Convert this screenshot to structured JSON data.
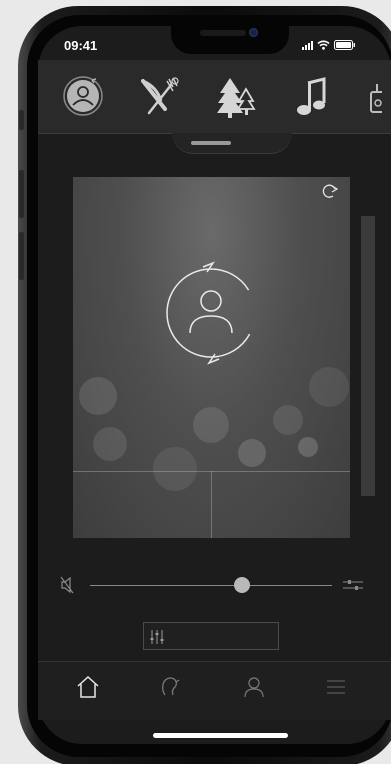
{
  "status_bar": {
    "time": "09:41"
  },
  "top_categories": [
    {
      "icon": "profile-sync-icon",
      "selected": true
    },
    {
      "icon": "knife-fork-icon",
      "selected": false
    },
    {
      "icon": "pine-trees-icon",
      "selected": false
    },
    {
      "icon": "music-note-icon",
      "selected": false
    },
    {
      "icon": "more-category-icon",
      "selected": false
    }
  ],
  "hero_card": {
    "icon": "profile-sync-icon",
    "corner_icon": "redo-arrow-icon"
  },
  "volume": {
    "level": 0.63,
    "mute_icon": "speaker-muted-icon",
    "settings_icon": "adjust-icon"
  },
  "eq_button": {
    "icon": "equalizer-icon"
  },
  "bottom_nav": [
    {
      "icon": "home-icon",
      "active": true
    },
    {
      "icon": "hearing-icon",
      "active": false
    },
    {
      "icon": "user-icon",
      "active": false
    },
    {
      "icon": "menu-icon",
      "active": false
    }
  ],
  "colors": {
    "screen_bg": "#1c1c1c",
    "top_bar_bg": "#2a2a2a",
    "icon_active": "#ffffff",
    "icon_inactive": "#8a8a8a"
  }
}
